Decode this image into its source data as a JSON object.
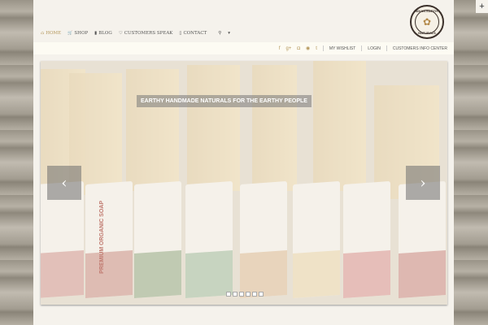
{
  "nav": [
    {
      "icon": "⌂",
      "label": "HOME"
    },
    {
      "icon": "🛒",
      "label": "SHOP"
    },
    {
      "icon": "▮",
      "label": "BLOG"
    },
    {
      "icon": "♡",
      "label": "CUSTOMERS SPEAK"
    },
    {
      "icon": "▯",
      "label": "CONTACT"
    }
  ],
  "logo": {
    "top": "INDIAN EARTHY",
    "bottom": "NATURALS"
  },
  "topbar": {
    "social": [
      "f",
      "g+",
      "◘",
      "◉",
      "t"
    ],
    "links": [
      "MY WISHLIST",
      "LOGIN",
      "CUSTOMERS INFO CENTER"
    ]
  },
  "slider": {
    "caption": "EARTHY HANDMADE NATURALS FOR THE EARTHY PEOPLE",
    "prev": "‹",
    "next": "›",
    "slide_count": 6,
    "soap_label": "PREMIUM ORGANIC SOAP"
  },
  "plus": "+"
}
